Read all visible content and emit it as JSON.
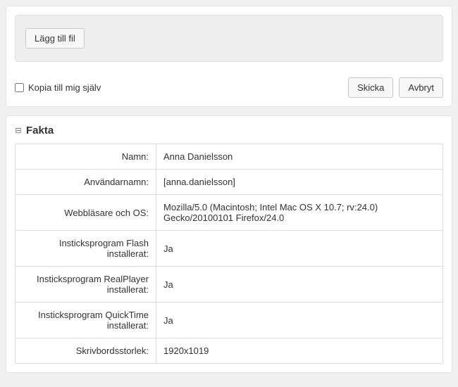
{
  "attach": {
    "add_file_label": "Lägg till fil"
  },
  "options": {
    "copy_to_self_label": "Kopia till mig själv"
  },
  "actions": {
    "submit_label": "Skicka",
    "cancel_label": "Avbryt"
  },
  "facts": {
    "title": "Fakta",
    "rows": {
      "name": {
        "label": "Namn:",
        "value": "Anna Danielsson"
      },
      "username": {
        "label": "Användarnamn:",
        "value": "[anna.danielsson]"
      },
      "browser_os": {
        "label": "Webbläsare och OS:",
        "value": "Mozilla/5.0 (Macintosh; Intel Mac OS X 10.7; rv:24.0) Gecko/20100101 Firefox/24.0"
      },
      "flash": {
        "label": "Insticksprogram Flash installerat:",
        "value": "Ja"
      },
      "realplayer": {
        "label": "Insticksprogram RealPlayer installerat:",
        "value": "Ja"
      },
      "quicktime": {
        "label": "Insticksprogram QuickTime installerat:",
        "value": "Ja"
      },
      "desktop": {
        "label": "Skrivbordsstorlek:",
        "value": "1920x1019"
      }
    }
  }
}
